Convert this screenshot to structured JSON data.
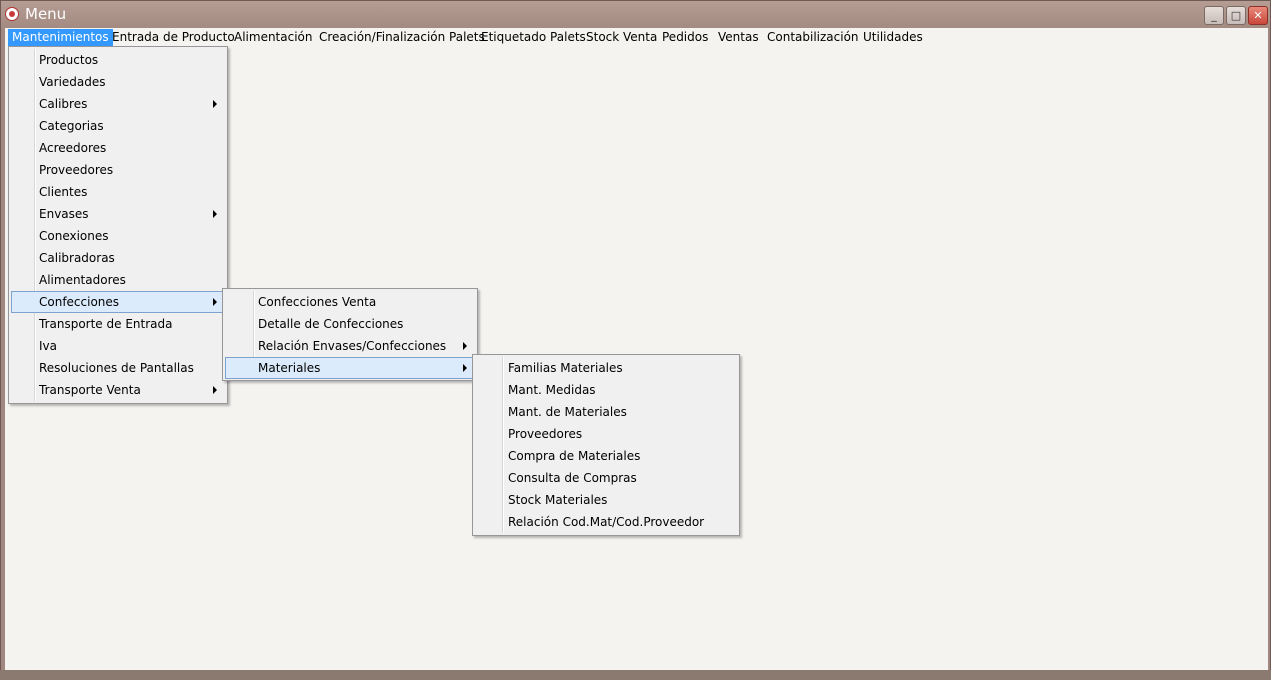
{
  "window": {
    "title": "Menu",
    "controls": {
      "minimize": "_",
      "maximize": "□",
      "close": "✕"
    }
  },
  "menubar": [
    "Mantenimientos",
    "Entrada de Producto",
    "Alimentación",
    "Creación/Finalización Palets",
    "Etiquetado Palets",
    "Stock Venta",
    "Pedidos",
    "Ventas",
    "Contabilización",
    "Utilidades"
  ],
  "mantenimientos_menu": [
    "Productos",
    "Variedades",
    "Calibres",
    "Categorias",
    "Acreedores",
    "Proveedores",
    "Clientes",
    "Envases",
    "Conexiones",
    "Calibradoras",
    "Alimentadores",
    "Confecciones",
    "Transporte de Entrada",
    "Iva",
    "Resoluciones de Pantallas",
    "Transporte Venta"
  ],
  "confecciones_menu": [
    "Confecciones Venta",
    "Detalle de Confecciones",
    "Relación Envases/Confecciones",
    "Materiales"
  ],
  "materiales_menu": [
    "Familias Materiales",
    "Mant. Medidas",
    "Mant. de Materiales",
    "Proveedores",
    "Compra de Materiales",
    "Consulta de Compras",
    "Stock Materiales",
    "Relación Cod.Mat/Cod.Proveedor"
  ],
  "colors": {
    "menubar_active": "#3399ff",
    "item_highlight": "#dcebfc",
    "item_highlight_border": "#7da2ce"
  }
}
